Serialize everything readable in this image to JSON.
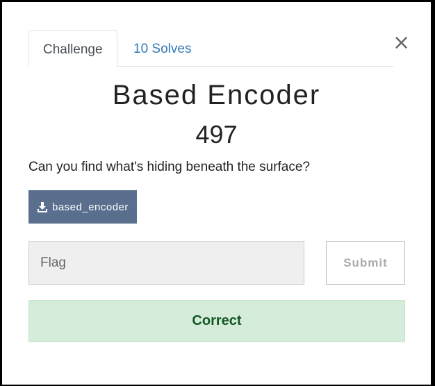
{
  "tabs": {
    "challenge_label": "Challenge",
    "solves_label": "10 Solves"
  },
  "challenge": {
    "name": "Based Encoder",
    "value": "497",
    "description": "Can you find what's hiding beneath the surface?",
    "file_label": "based_encoder"
  },
  "form": {
    "flag_placeholder": "Flag",
    "flag_value": "",
    "submit_label": "Submit"
  },
  "result": {
    "message": "Correct"
  },
  "icons": {
    "close": "close-icon",
    "download": "download-icon"
  },
  "colors": {
    "link": "#337ab7",
    "download_button": "#5a6f8e",
    "success_bg": "#d4ecd9",
    "success_text": "#155724"
  }
}
